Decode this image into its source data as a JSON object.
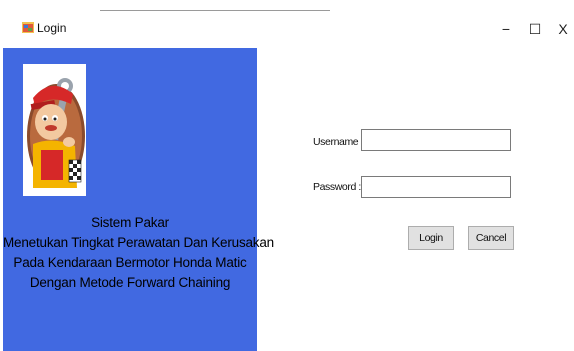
{
  "window": {
    "title": "Login",
    "minimize_glyph": "−",
    "maximize_glyph": "☐",
    "close_glyph": "X"
  },
  "panel": {
    "background": "#4169e1",
    "mascot_icon": "mechanic-mascot-icon",
    "lines": [
      "Sistem Pakar",
      "Menetukan Tingkat Perawatan Dan Kerusakan",
      "Pada Kendaraan Bermotor Honda Matic",
      "Dengan Metode Forward Chaining"
    ]
  },
  "form": {
    "username_label": "Username :",
    "username_value": "",
    "password_label": "Password :",
    "password_value": "",
    "login_label": "Login",
    "cancel_label": "Cancel"
  }
}
